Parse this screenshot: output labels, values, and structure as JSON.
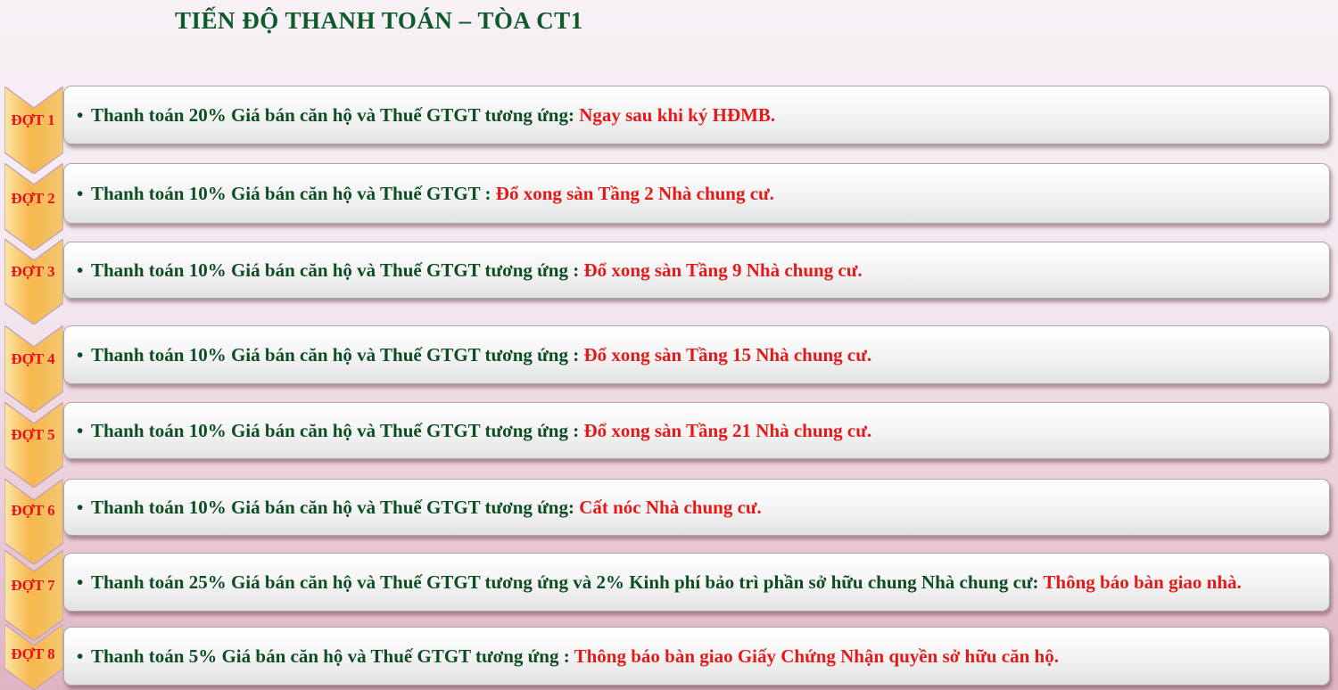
{
  "title": "TIẾN ĐỘ THANH TOÁN – TÒA CT1",
  "bullet": "•",
  "steps": [
    {
      "label": "ĐỢT 1",
      "main": "Thanh toán  20%  Giá bán căn hộ và Thuế GTGT tương ứng:  ",
      "red": "Ngay sau khi ký HĐMB."
    },
    {
      "label": "ĐỢT 2",
      "main": "Thanh toán 10%  Giá bán căn hộ và Thuế GTGT : ",
      "red": "Đổ xong sàn Tầng 2 Nhà chung cư."
    },
    {
      "label": "ĐỢT 3",
      "main": "Thanh toán 10%  Giá bán căn hộ và Thuế GTGT tương ứng : ",
      "red": "Đổ xong sàn Tầng  9 Nhà chung cư."
    },
    {
      "label": "ĐỢT 4",
      "main": "Thanh toán 10%  Giá bán căn hộ và Thuế GTGT tương ứng : ",
      "red": "Đổ xong sàn Tầng 15 Nhà chung cư."
    },
    {
      "label": "ĐỢT 5",
      "main": "Thanh toán 10%  Giá bán căn hộ và Thuế GTGT tương ứng : ",
      "red": "Đổ xong sàn Tầng  21 Nhà chung cư."
    },
    {
      "label": "ĐỢT 6",
      "main": "Thanh toán 10%  Giá bán căn hộ và Thuế GTGT tương ứng: ",
      "red": "Cất nóc Nhà chung cư."
    },
    {
      "label": "ĐỢT 7",
      "main": "Thanh toán  25%  Giá bán căn hộ và Thuế GTGT tương ứng và 2% Kinh phí bảo trì phần sở hữu chung Nhà chung cư: ",
      "red": "Thông báo bàn giao nhà."
    },
    {
      "label": "ĐỢT 8",
      "main": "Thanh toán  5%  Giá bán căn hộ và Thuế GTGT tương ứng : ",
      "red": "Thông báo bàn giao Giấy Chứng Nhận quyền sở hữu căn hộ."
    }
  ]
}
